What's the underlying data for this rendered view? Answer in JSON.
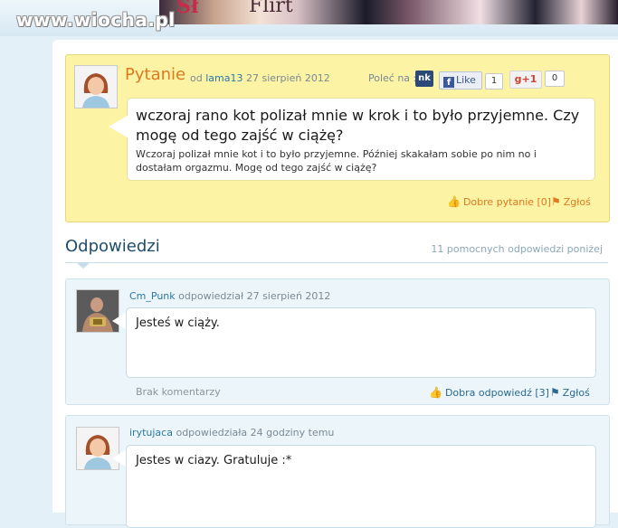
{
  "site": {
    "logo": "www.wiocha.pl"
  },
  "banner": {
    "text_a": "Sł",
    "text_b": "Flirt"
  },
  "question": {
    "title": "Pytanie",
    "from_prefix": "od",
    "author": "lama13",
    "date": "27 sierpień 2012",
    "recommend_label": "Poleć na :",
    "nk_label": "nk",
    "fb_label": "Like",
    "fb_count": "1",
    "gplus_label": "+1",
    "gplus_count": "0",
    "headline": "wczoraj rano kot polizał mnie w krok i to było przyjemne. Czy mogę od tego zajść w ciążę?",
    "body": "Wczoraj polizał mnie kot i to było przyjemne. Później skakałam sobie po nim no i dostałam orgazmu. Mogę od tego zajść w ciążę?",
    "good_question_label": "Dobre pytanie [0]",
    "report_label": "Zgłoś"
  },
  "answers": {
    "heading": "Odpowiedzi",
    "count_label": "11 pomocnych odpowiedzi poniżej",
    "items": [
      {
        "author": "Cm_Punk",
        "meta": "odpowiedział 27 sierpień 2012",
        "text": "Jesteś w ciąży.",
        "no_comments": "Brak komentarzy",
        "good_answer_label": "Dobra odpowiedź [3]",
        "report_label": "Zgłoś"
      },
      {
        "author": "irytujaca",
        "meta": "odpowiedziała 24 godziny temu",
        "text": "Jestes w ciazy. Gratuluje :*"
      }
    ]
  },
  "colors": {
    "accent": "#e07820",
    "link": "#2a7aa8",
    "question_bg": "#fcf3a4",
    "answer_bg": "#ecf5fa"
  },
  "icons": [
    "thumbs-up-icon",
    "flag-icon",
    "facebook-icon",
    "google-plus-icon",
    "avatar-icon"
  ]
}
